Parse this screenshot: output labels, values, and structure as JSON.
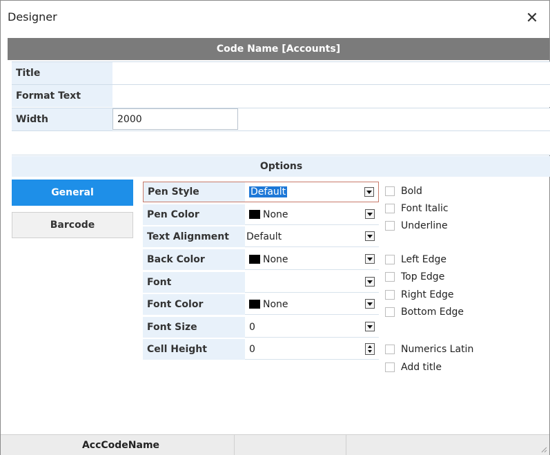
{
  "window": {
    "title": "Designer",
    "close_glyph": "✕"
  },
  "header": {
    "title": "Code Name [Accounts]"
  },
  "properties": {
    "title_label": "Title",
    "title_value": "",
    "format_label": "Format Text",
    "format_value": "",
    "width_label": "Width",
    "width_value": "2000"
  },
  "options": {
    "title": "Options",
    "tabs": [
      {
        "label": "General",
        "active": true
      },
      {
        "label": "Barcode",
        "active": false
      }
    ],
    "rows": [
      {
        "label": "Pen Style",
        "value": "Default",
        "swatch": false,
        "control": "dropdown",
        "selected": true
      },
      {
        "label": "Pen Color",
        "value": "None",
        "swatch": true,
        "control": "dropdown"
      },
      {
        "label": "Text Alignment",
        "value": "Default",
        "swatch": false,
        "control": "dropdown"
      },
      {
        "label": "Back Color",
        "value": "None",
        "swatch": true,
        "control": "dropdown"
      },
      {
        "label": "Font",
        "value": "",
        "swatch": false,
        "control": "dropdown"
      },
      {
        "label": "Font Color",
        "value": "None",
        "swatch": true,
        "control": "dropdown"
      },
      {
        "label": "Font Size",
        "value": "0",
        "swatch": false,
        "control": "dropdown"
      },
      {
        "label": "Cell Height",
        "value": "0",
        "swatch": false,
        "control": "spinner"
      }
    ],
    "checkboxes": [
      {
        "label": "Bold",
        "checked": false
      },
      {
        "label": "Font Italic",
        "checked": false
      },
      {
        "label": "Underline",
        "checked": false
      },
      {
        "label": "Left Edge",
        "checked": false
      },
      {
        "label": "Top Edge",
        "checked": false
      },
      {
        "label": "Right Edge",
        "checked": false
      },
      {
        "label": "Bottom Edge",
        "checked": false
      },
      {
        "label": "Numerics Latin",
        "checked": false
      },
      {
        "label": "Add title",
        "checked": false
      }
    ]
  },
  "footer": {
    "col1": "AccCodeName"
  },
  "colors": {
    "accent": "#1e8fe8",
    "header_bg": "#7b7b7b",
    "label_bg": "#e8f1fa",
    "swatch": "#000000"
  }
}
